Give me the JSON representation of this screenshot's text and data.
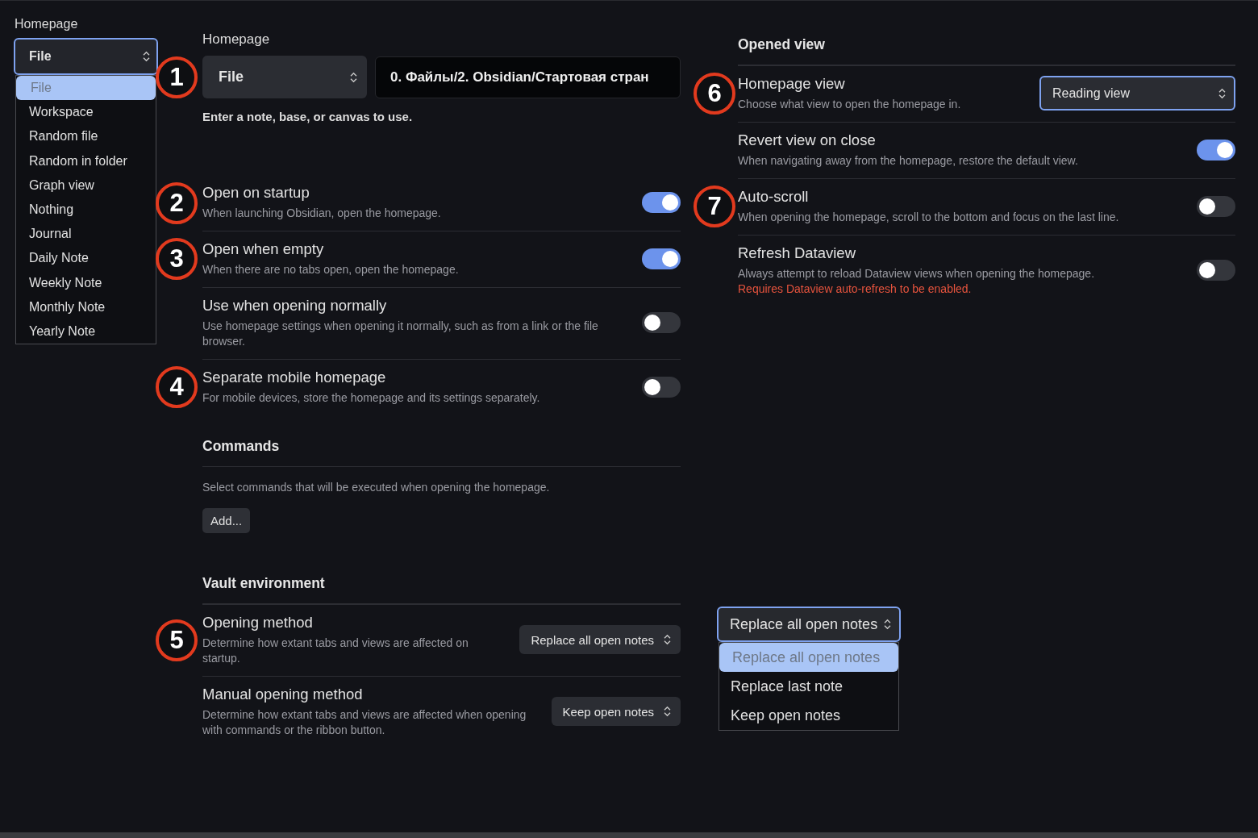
{
  "columns": [
    {
      "blocks": [
        {
          "kind": "dropdown-menu",
          "label": "Homepage",
          "value": "File",
          "focused": true,
          "options": [
            {
              "label": "File",
              "selected": true
            },
            {
              "label": "Workspace",
              "selected": false
            },
            {
              "label": "Random file",
              "selected": false
            },
            {
              "label": "Random in folder",
              "selected": false
            },
            {
              "label": "Graph view",
              "selected": false
            },
            {
              "label": "Nothing",
              "selected": false
            },
            {
              "label": "Journal",
              "selected": false
            },
            {
              "label": "Daily Note",
              "selected": false
            },
            {
              "label": "Weekly Note",
              "selected": false
            },
            {
              "label": "Monthly Note",
              "selected": false
            },
            {
              "label": "Yearly Note",
              "selected": false
            }
          ]
        }
      ]
    },
    {
      "blocks": [
        {
          "kind": "homepage-picker",
          "label": "Homepage",
          "badge": "1",
          "type_value": "File",
          "path_value": "0. Файлы/2. Obsidian/Стартовая стран",
          "hint": "Enter a note, base, or canvas to use."
        },
        {
          "kind": "settings",
          "settings": [
            {
              "badge": "2",
              "title": "Open on startup",
              "description": "When launching Obsidian, open the homepage.",
              "kind": "toggle",
              "on": true
            },
            {
              "badge": "3",
              "title": "Open when empty",
              "description": "When there are no tabs open, open the homepage.",
              "kind": "toggle",
              "on": true
            },
            {
              "title": "Use when opening normally",
              "description": "Use homepage settings when opening it normally, such as from a link or the file browser.",
              "kind": "toggle",
              "on": false
            },
            {
              "badge": "4",
              "title": "Separate mobile homepage",
              "description": "For mobile devices, store the homepage and its settings separately.",
              "kind": "toggle",
              "on": false
            }
          ]
        },
        {
          "kind": "commands",
          "heading": "Commands",
          "description": "Select commands that will be executed when opening the homepage.",
          "button": "Add..."
        },
        {
          "kind": "settings",
          "heading": "Vault environment",
          "settings": [
            {
              "badge": "5",
              "title": "Opening method",
              "description": "Determine how extant tabs and views are affected on startup.",
              "kind": "select",
              "value": "Replace all open notes",
              "focused": false
            },
            {
              "title": "Manual opening method",
              "description": "Determine how extant tabs and views are affected when opening with commands or the ribbon button.",
              "kind": "select",
              "value": "Keep open notes",
              "focused": false
            }
          ]
        }
      ]
    },
    {
      "blocks": [
        {
          "kind": "settings",
          "heading": "Opened view",
          "settings": [
            {
              "badge": "6",
              "title": "Homepage view",
              "description": "Choose what view to open the homepage in.",
              "kind": "select",
              "value": "Reading view",
              "focused": true
            },
            {
              "title": "Revert view on close",
              "description": "When navigating away from the homepage, restore the default view.",
              "kind": "toggle",
              "on": true
            },
            {
              "badge": "7",
              "title": "Auto-scroll",
              "description": "When opening the homepage, scroll to the bottom and focus on the last line.",
              "kind": "toggle",
              "on": false
            },
            {
              "title": "Refresh Dataview",
              "description": "Always attempt to reload Dataview views when opening the homepage.",
              "warning": "Requires Dataview auto-refresh to be enabled.",
              "kind": "toggle",
              "on": false
            }
          ]
        },
        {
          "kind": "dropdown-menu",
          "value": "Replace all open notes",
          "focused": true,
          "options": [
            {
              "label": "Replace all open notes",
              "selected": true
            },
            {
              "label": "Replace last note",
              "selected": false
            },
            {
              "label": "Keep open notes",
              "selected": false
            }
          ]
        }
      ]
    }
  ]
}
